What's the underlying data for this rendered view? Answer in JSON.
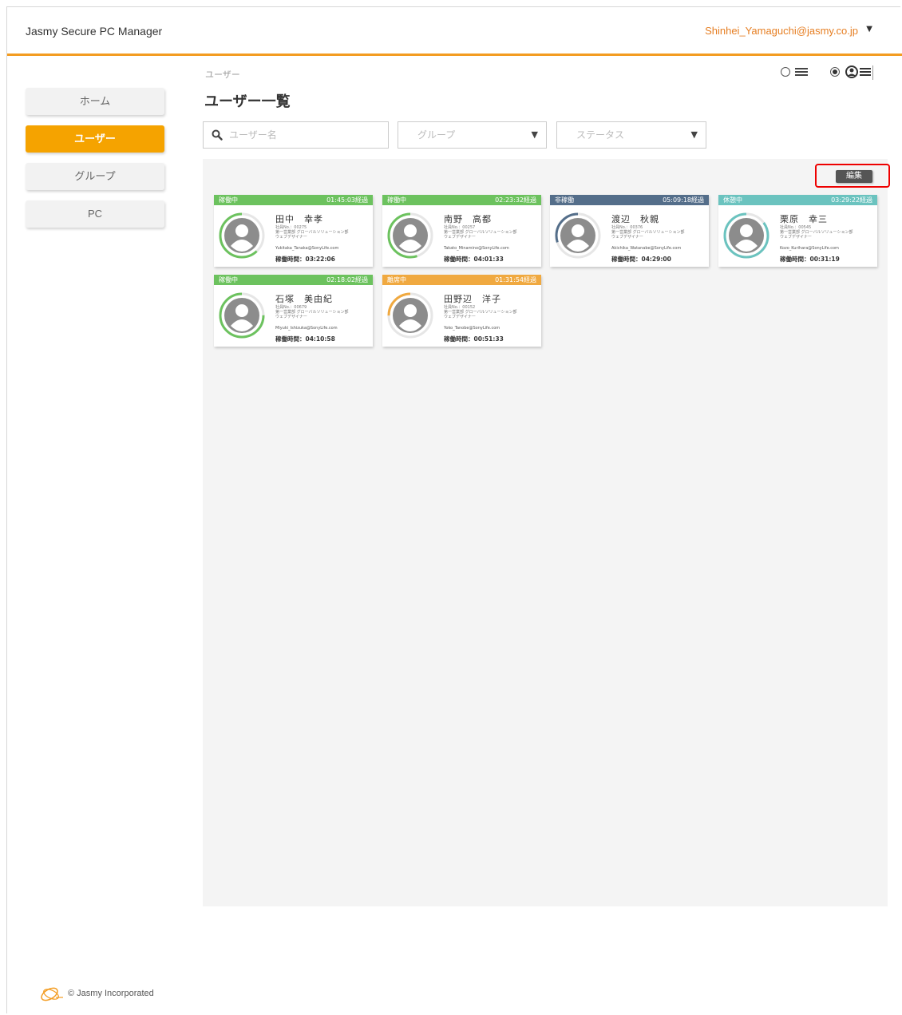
{
  "header": {
    "app_title": "Jasmy Secure PC Manager",
    "user_email": "Shinhei_Yamaguchi@jasmy.co.jp",
    "caret": "▼",
    "accent_color": "#f39c21"
  },
  "sidebar": {
    "items": [
      {
        "label": "ホーム",
        "active": false
      },
      {
        "label": "ユーザー",
        "active": true
      },
      {
        "label": "グループ",
        "active": false
      },
      {
        "label": "PC",
        "active": false
      }
    ]
  },
  "main": {
    "breadcrumb": "ユーザー",
    "title": "ユーザー一覧",
    "view_mode": "card",
    "filters": {
      "search_placeholder": "ユーザー名",
      "group_placeholder": "グループ",
      "status_placeholder": "ステータス"
    },
    "edit_label": "編集"
  },
  "cards": [
    {
      "status": "稼働中",
      "elapsed": "01:45:03経過",
      "name": "田中　幸孝",
      "employee_no": "社員No.：00275",
      "dept": "第一営業部 グローバルソリューション部",
      "team": "ウェブデザイナー",
      "email": "Yukitaka_Tanaka@SonyLife.com",
      "work_time": "稼働時間：03:22:06",
      "color": "#6cc25e"
    },
    {
      "status": "稼働中",
      "elapsed": "02:23:32経過",
      "name": "南野　高都",
      "employee_no": "社員No.：00257",
      "dept": "第一営業部 グローバルソリューション部",
      "team": "ウェブデザイナー",
      "email": "Takato_Minamino@SonyLife.com",
      "work_time": "稼働時間：04:01:33",
      "color": "#6cc25e"
    },
    {
      "status": "非稼働",
      "elapsed": "05:09:18経過",
      "name": "渡辺　秋親",
      "employee_no": "社員No.：00376",
      "dept": "第一営業部 グローバルソリューション部",
      "team": "ウェブデザイナー",
      "email": "Akichika_Watanabe@SonyLife.com",
      "work_time": "稼働時間：04:29:00",
      "color": "#546e8a"
    },
    {
      "status": "休憩中",
      "elapsed": "03:29:22経過",
      "name": "栗原　幸三",
      "employee_no": "社員No.：00545",
      "dept": "第一営業部 グローバルソリューション部",
      "team": "ウェブデザイナー",
      "email": "Kozo_Kurihara@SonyLife.com",
      "work_time": "稼働時間：00:31:19",
      "color": "#6bc3bf"
    },
    {
      "status": "稼働中",
      "elapsed": "02:18:02経過",
      "name": "石塚　美由紀",
      "employee_no": "社員No.：00679",
      "dept": "第一営業部 グローバルソリューション部",
      "team": "ウェブデザイナー",
      "email": "Miyuki_Ishizuka@SonyLife.com",
      "work_time": "稼働時間：04:10:58",
      "color": "#6cc25e"
    },
    {
      "status": "離席中",
      "elapsed": "01:31:54経過",
      "name": "田野辺　洋子",
      "employee_no": "社員No.：00152",
      "dept": "第一営業部 グローバルソリューション部",
      "team": "ウェブデザイナー",
      "email": "Yoko_Tanobe@SonyLife.com",
      "work_time": "稼働時間：00:51:33",
      "color": "#f0a940"
    }
  ],
  "footer": {
    "copyright": "© Jasmy Incorporated"
  }
}
